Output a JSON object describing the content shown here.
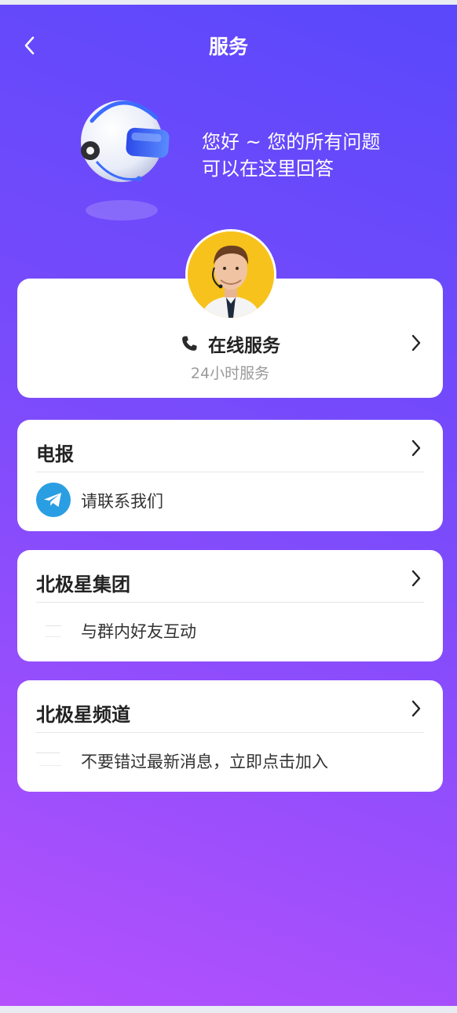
{
  "header": {
    "title": "服务",
    "back_icon": "chevron-left-icon"
  },
  "hero": {
    "line1": "您好 ~ 您的所有问题",
    "line2": "可以在这里回答",
    "illustration_icon": "headset-robot-icon"
  },
  "online_service": {
    "title": "在线服务",
    "subtitle": "24小时服务",
    "phone_icon": "phone-icon",
    "avatar": "agent-avatar"
  },
  "sections": [
    {
      "title": "电报",
      "text": "请联系我们",
      "icon": "telegram-icon"
    },
    {
      "title": "北极星集团",
      "text": "与群内好友互动",
      "icon": "group-icon"
    },
    {
      "title": "北极星频道",
      "text": "不要错过最新消息，立即点击加入",
      "icon": "channel-icon"
    }
  ],
  "colors": {
    "gradient_top": "#5a48fb",
    "gradient_bottom": "#b451fd",
    "telegram_blue": "#2a9ee3",
    "avatar_bg": "#f7c21c"
  }
}
